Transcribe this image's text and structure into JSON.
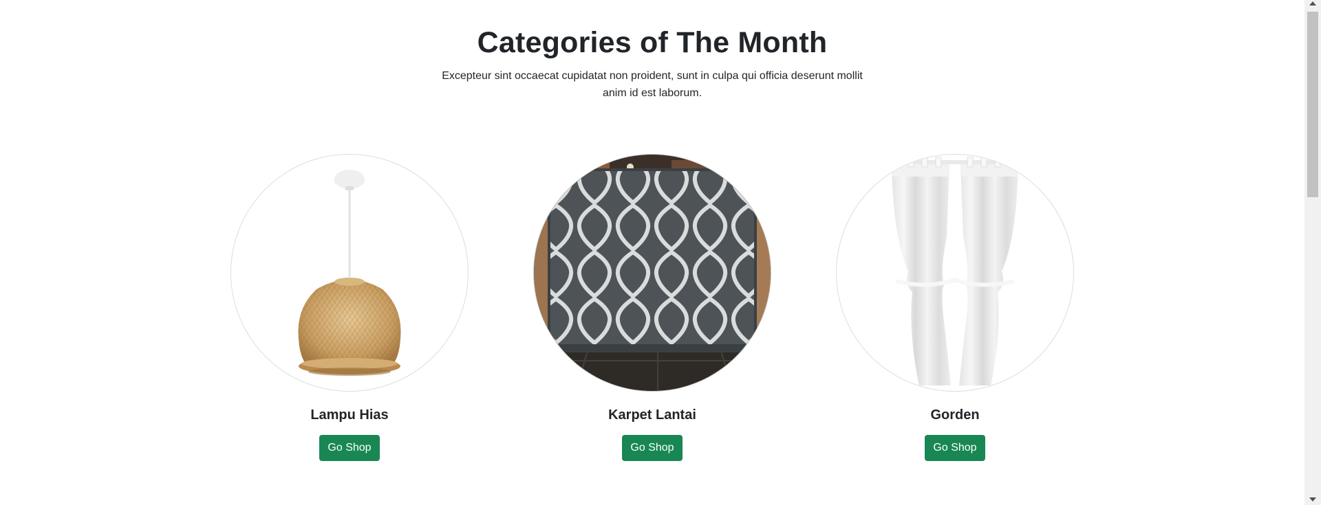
{
  "section": {
    "title": "Categories of The Month",
    "description": "Excepteur sint occaecat cupidatat non proident, sunt in culpa qui officia deserunt mollit anim id est laborum."
  },
  "categories": [
    {
      "name": "Lampu Hias",
      "button_label": "Go Shop",
      "image": "rattan-pendant-lamp"
    },
    {
      "name": "Karpet Lantai",
      "button_label": "Go Shop",
      "image": "grey-patterned-rug"
    },
    {
      "name": "Gorden",
      "button_label": "Go Shop",
      "image": "white-curtains"
    }
  ],
  "colors": {
    "button_bg": "#198754",
    "text": "#212529"
  }
}
